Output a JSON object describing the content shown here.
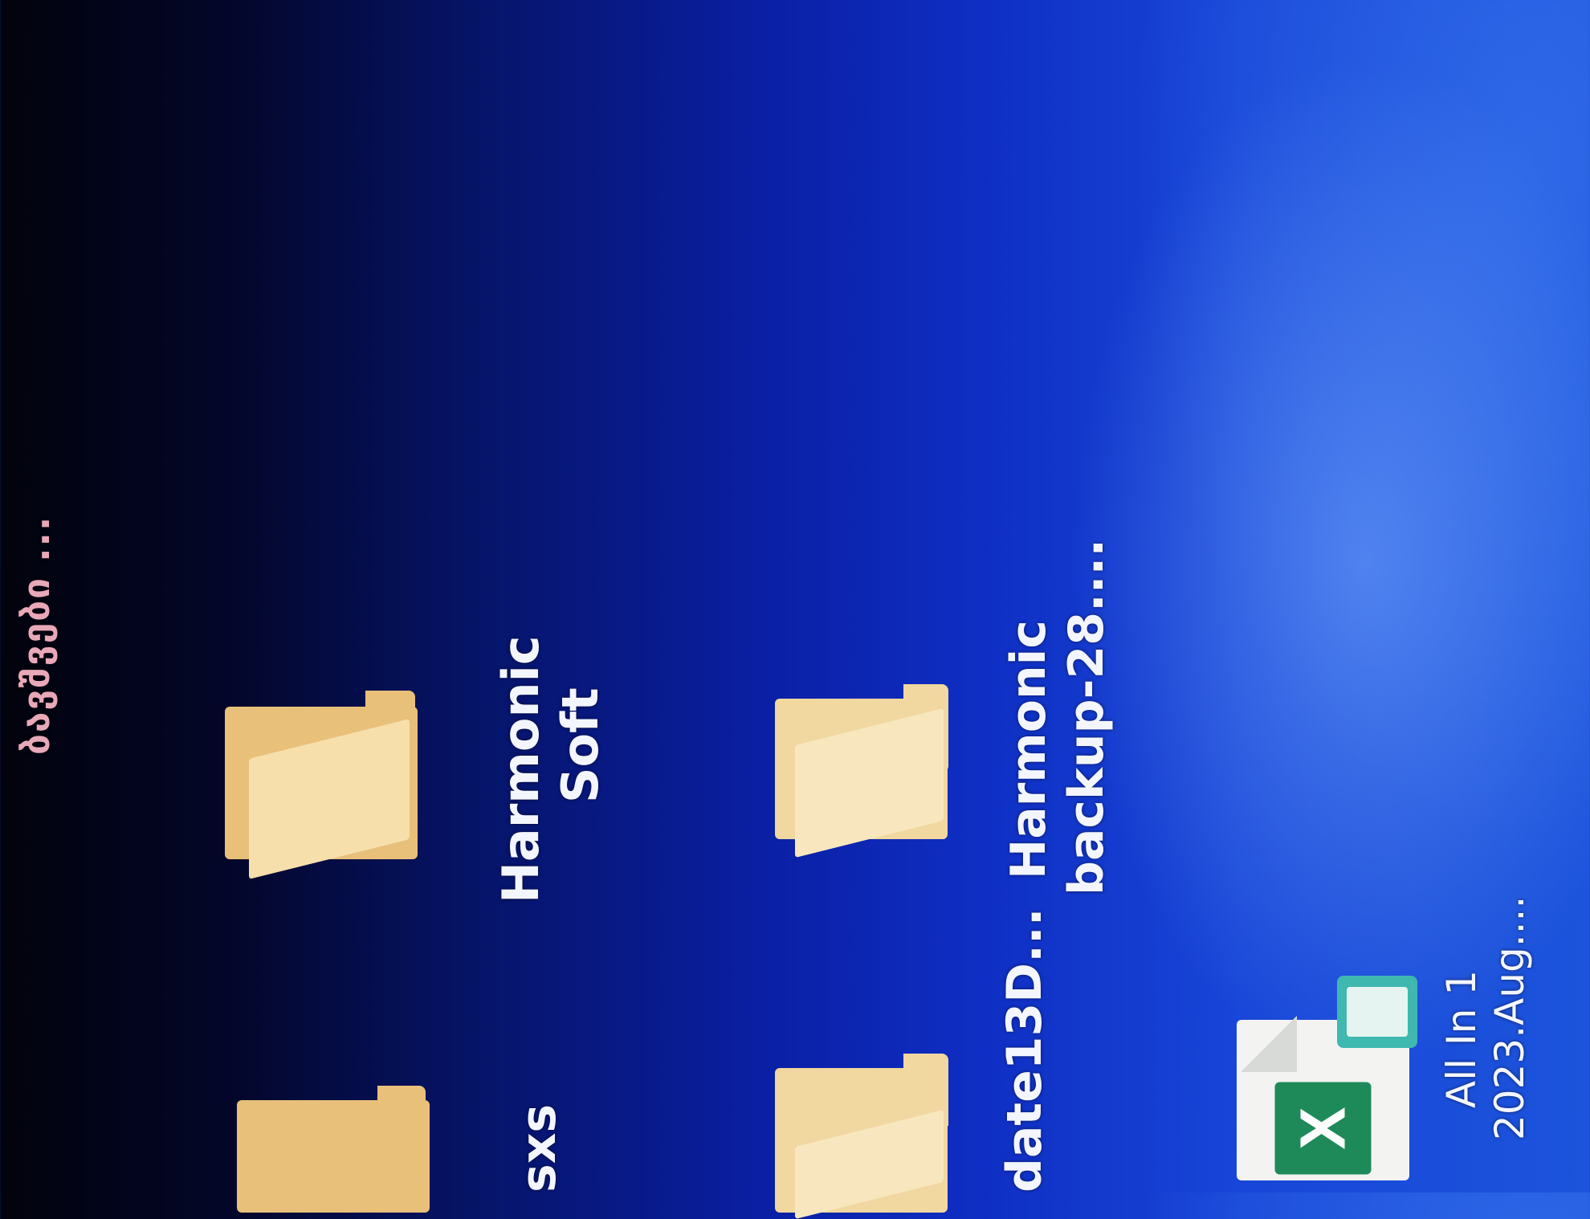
{
  "desktop": {
    "top_label": "ბავშვები ...",
    "icons": [
      {
        "label_line1": "Harmonic",
        "label_line2": "Soft",
        "type": "folder"
      },
      {
        "label_line1": "Harmonic",
        "label_line2": "backup-28....",
        "type": "folder"
      },
      {
        "label_line1": "sxs",
        "type": "folder"
      },
      {
        "label_line1": "date13D...",
        "type": "folder"
      },
      {
        "label_line1": "All In 1",
        "label_line2": "2023.Aug....",
        "type": "excel-file"
      }
    ]
  },
  "colors": {
    "folder_back": "#e8c07a",
    "folder_front": "#f6dfaa",
    "excel_green": "#1e8a5a",
    "teal_badge": "#3fb8b0"
  }
}
